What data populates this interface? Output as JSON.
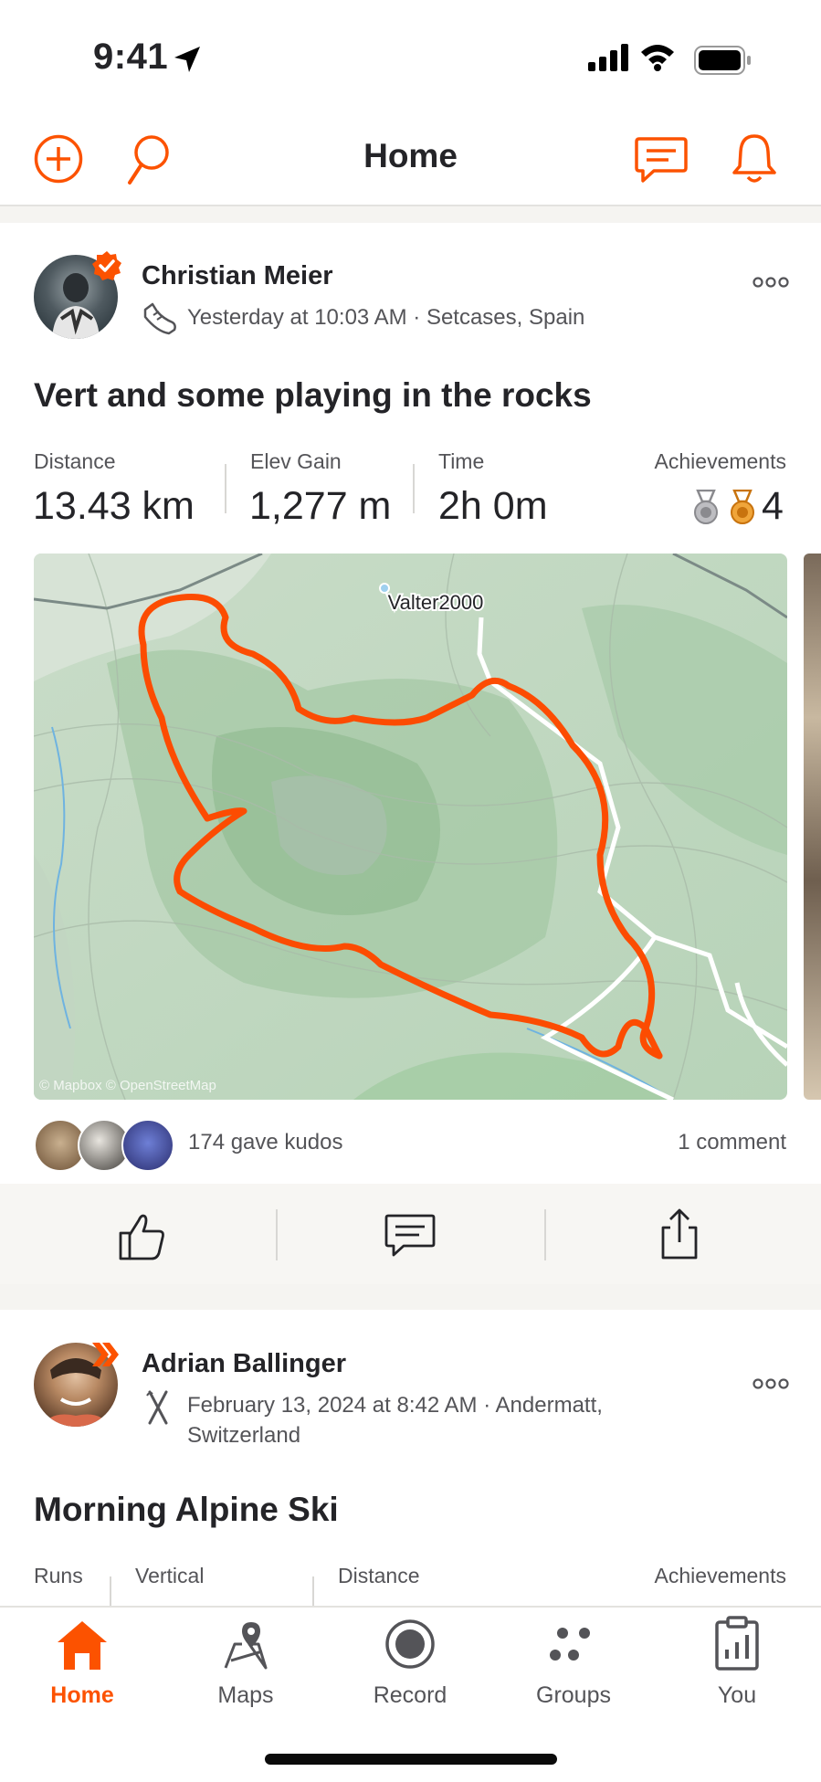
{
  "status_bar": {
    "time": "9:41"
  },
  "header": {
    "title": "Home"
  },
  "colors": {
    "accent": "#fc5200",
    "text": "#242428",
    "muted": "#545458"
  },
  "feed": [
    {
      "athlete": "Christian Meier",
      "meta": "Yesterday at 10:03 AM · Setcases, Spain",
      "activity_icon": "shoe-icon",
      "title": "Vert and some playing in the rocks",
      "stats": [
        {
          "label": "Distance",
          "value": "13.43 km"
        },
        {
          "label": "Elev Gain",
          "value": "1,277 m"
        },
        {
          "label": "Time",
          "value": "2h 0m"
        }
      ],
      "achievements": {
        "label": "Achievements",
        "count": "4"
      },
      "map": {
        "place_label": "Valter2000",
        "attribution": "© Mapbox © OpenStreetMap"
      },
      "kudos": "174 gave kudos",
      "comments": "1 comment"
    },
    {
      "athlete": "Adrian Ballinger",
      "meta_line1": "February 13, 2024 at 8:42 AM · Andermatt,",
      "meta_line2": "Switzerland",
      "activity_icon": "ski-icon",
      "title": "Morning Alpine Ski",
      "stats": [
        {
          "label": "Runs"
        },
        {
          "label": "Vertical"
        },
        {
          "label": "Distance"
        }
      ],
      "achievements": {
        "label": "Achievements"
      }
    }
  ],
  "tabs": [
    {
      "label": "Home",
      "icon": "home-icon",
      "active": true
    },
    {
      "label": "Maps",
      "icon": "map-pin-icon",
      "active": false
    },
    {
      "label": "Record",
      "icon": "record-icon",
      "active": false
    },
    {
      "label": "Groups",
      "icon": "groups-icon",
      "active": false
    },
    {
      "label": "You",
      "icon": "profile-chart-icon",
      "active": false
    }
  ]
}
